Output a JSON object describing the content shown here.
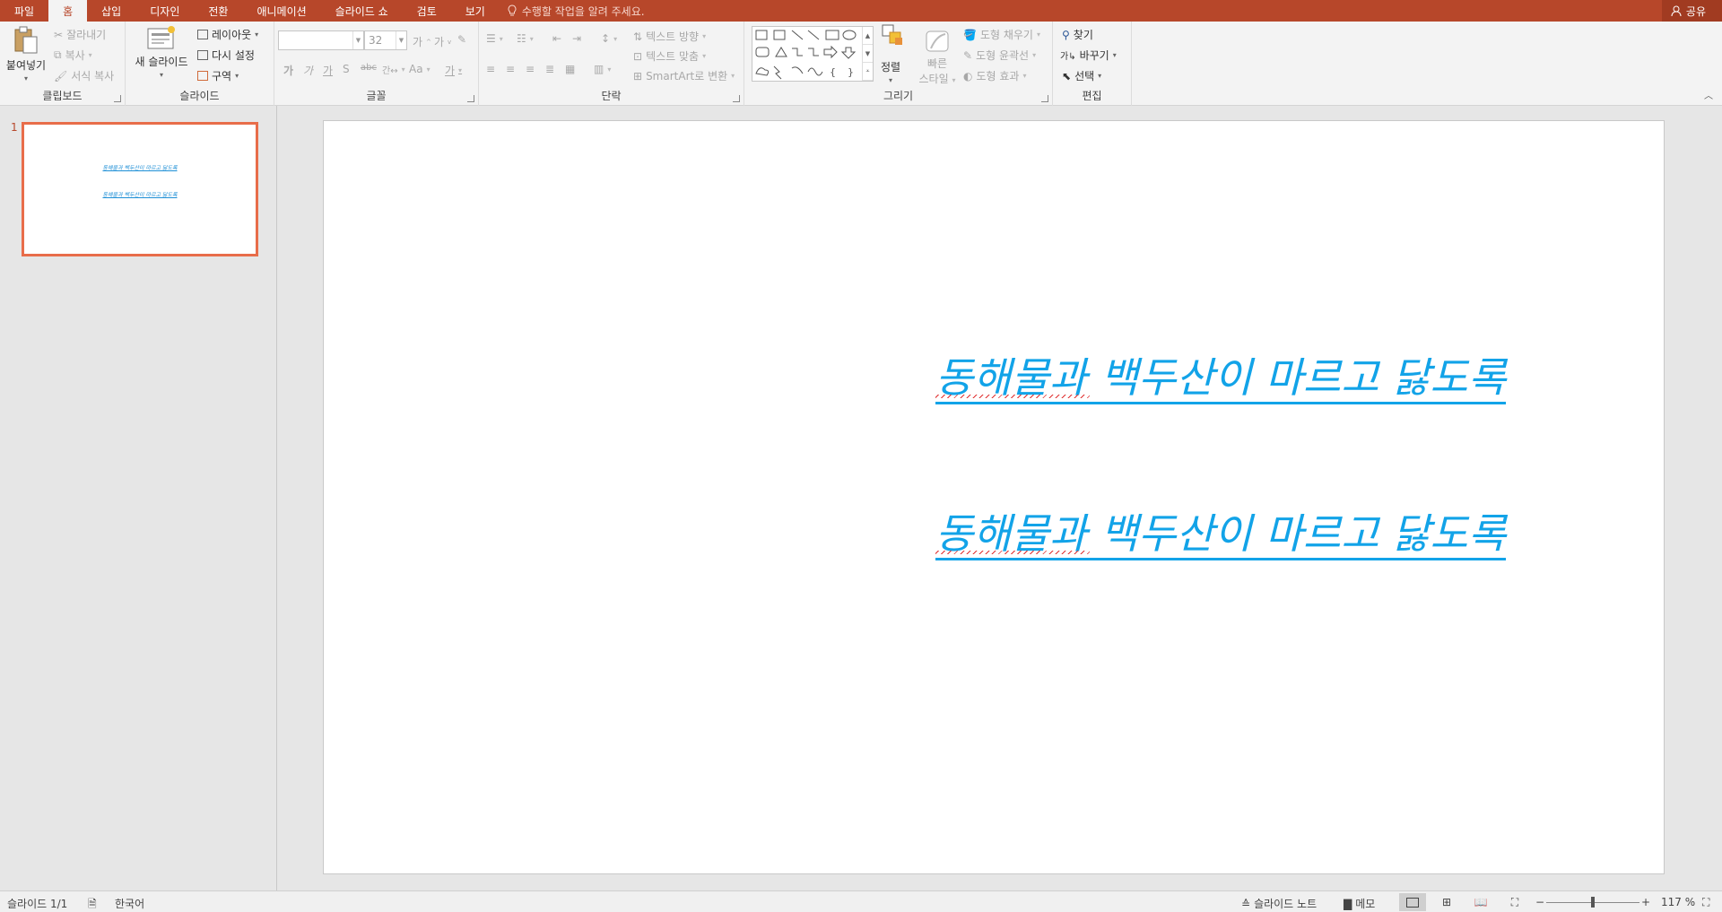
{
  "tabs": [
    "파일",
    "홈",
    "삽입",
    "디자인",
    "전환",
    "애니메이션",
    "슬라이드 쇼",
    "검토",
    "보기"
  ],
  "active_tab_index": 1,
  "tell_me": "수행할 작업을 알려 주세요.",
  "share": "공유",
  "clipboard": {
    "paste": "붙여넣기",
    "cut": "잘라내기",
    "copy": "복사",
    "format_painter": "서식 복사",
    "label": "클립보드"
  },
  "slides_group": {
    "new_slide": "새 슬라이드",
    "layout": "레이아웃",
    "reset": "다시 설정",
    "section": "구역",
    "label": "슬라이드"
  },
  "font_group": {
    "font_name": "",
    "font_size": "32",
    "label": "글꼴"
  },
  "paragraph_group": {
    "text_direction": "텍스트 방향",
    "align_text": "텍스트 맞춤",
    "smartart": "SmartArt로 변환",
    "label": "단락"
  },
  "drawing_group": {
    "arrange": "정렬",
    "quick_styles_1": "빠른",
    "quick_styles_2": "스타일",
    "shape_fill": "도형 채우기",
    "shape_outline": "도형 윤곽선",
    "shape_effects": "도형 효과",
    "label": "그리기"
  },
  "editing_group": {
    "find": "찾기",
    "replace": "바꾸기",
    "select": "선택",
    "label": "편집"
  },
  "thumbnail": {
    "number": "1",
    "line1": "동해물과 백두산이 마르고 닳도록",
    "line2": "동해물과 백두산이 마르고 닳도록"
  },
  "slide": {
    "line1": "동해물과 백두산이 마르고 닳도록",
    "line2": "동해물과 백두산이 마르고 닳도록"
  },
  "status": {
    "slide_info": "슬라이드 1/1",
    "language": "한국어",
    "notes": "슬라이드 노트",
    "comments": "메모",
    "zoom": "117 %"
  },
  "colors": {
    "accent": "#b7472a",
    "slide_text": "#12a3e8",
    "selection": "#e86d4a"
  }
}
